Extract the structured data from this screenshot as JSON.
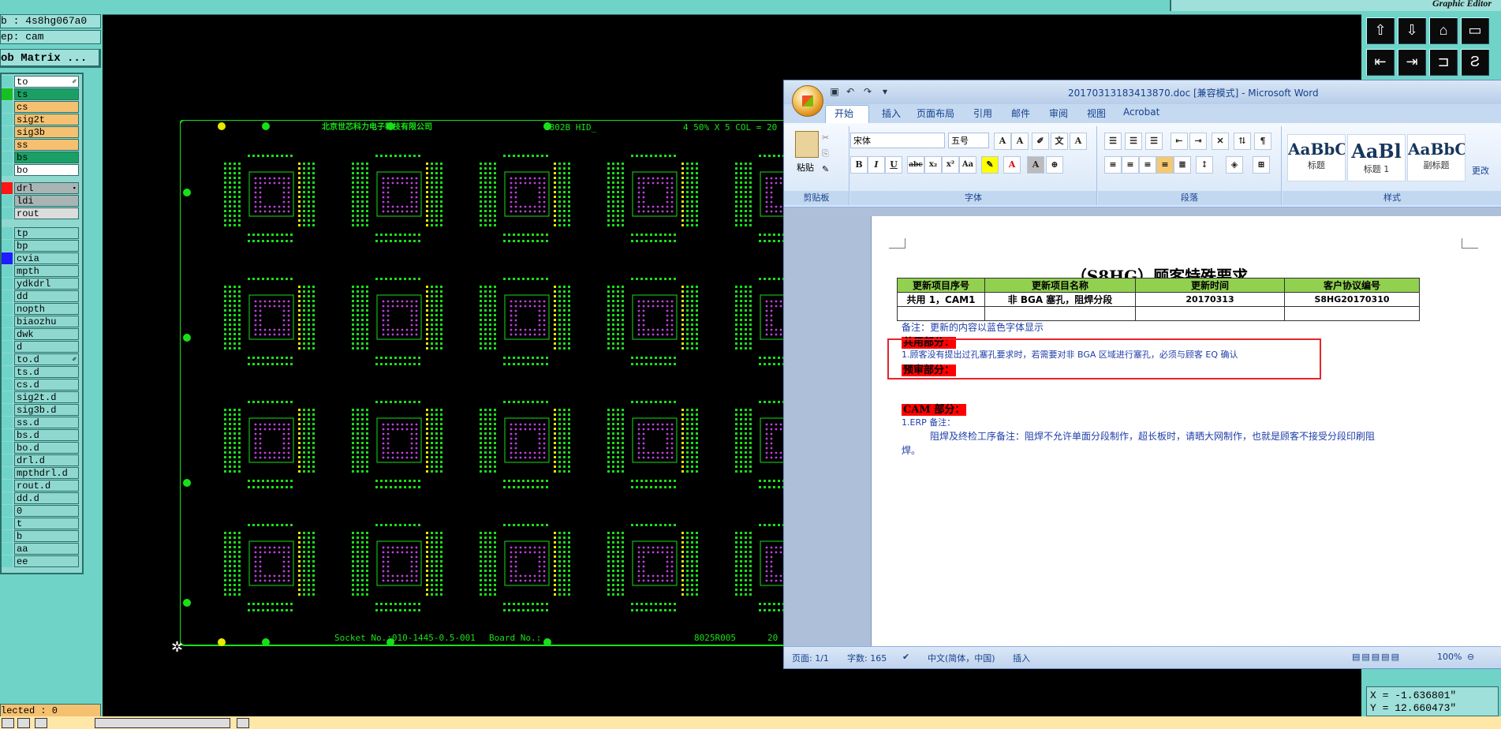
{
  "topbar": {
    "right_label": "Graphic Editor"
  },
  "left_panel": {
    "job": "b : 4s8hg067a0",
    "step": "ep: cam",
    "matrix_button": "ob Matrix ...",
    "selected": "lected : 0",
    "layers": [
      {
        "name": "to",
        "bg": "#ffffff",
        "swatch": "#6fd3c8",
        "flag": "✐"
      },
      {
        "name": "ts",
        "bg": "#1aa064",
        "swatch": "#15c022",
        "flag": ""
      },
      {
        "name": "cs",
        "bg": "#f5c070",
        "swatch": "#6fd3c8",
        "flag": ""
      },
      {
        "name": "sig2t",
        "bg": "#f5c070",
        "swatch": "#6fd3c8",
        "flag": ""
      },
      {
        "name": "sig3b",
        "bg": "#f5c070",
        "swatch": "#6fd3c8",
        "flag": ""
      },
      {
        "name": "ss",
        "bg": "#f5c070",
        "swatch": "#6fd3c8",
        "flag": ""
      },
      {
        "name": "bs",
        "bg": "#1aa064",
        "swatch": "#6fd3c8",
        "flag": ""
      },
      {
        "name": "bo",
        "bg": "#ffffff",
        "swatch": "#6fd3c8",
        "flag": ""
      },
      {
        "name": "drl",
        "bg": "#a9b4b4",
        "swatch": "#ff1515",
        "flag": "▪"
      },
      {
        "name": "ldi",
        "bg": "#a9b4b4",
        "swatch": "#6fd3c8",
        "flag": ""
      },
      {
        "name": "rout",
        "bg": "#dcdcdc",
        "swatch": "#6fd3c8",
        "flag": ""
      },
      {
        "name": "tp",
        "bg": "#8fd8d0",
        "swatch": "#6fd3c8",
        "flag": ""
      },
      {
        "name": "bp",
        "bg": "#8fd8d0",
        "swatch": "#6fd3c8",
        "flag": ""
      },
      {
        "name": "cvia",
        "bg": "#8fd8d0",
        "swatch": "#1d1dff",
        "flag": ""
      },
      {
        "name": "mpth",
        "bg": "#8fd8d0",
        "swatch": "#6fd3c8",
        "flag": ""
      },
      {
        "name": "ydkdrl",
        "bg": "#8fd8d0",
        "swatch": "#6fd3c8",
        "flag": ""
      },
      {
        "name": "dd",
        "bg": "#8fd8d0",
        "swatch": "#6fd3c8",
        "flag": ""
      },
      {
        "name": "nopth",
        "bg": "#8fd8d0",
        "swatch": "#6fd3c8",
        "flag": ""
      },
      {
        "name": "biaozhu",
        "bg": "#8fd8d0",
        "swatch": "#6fd3c8",
        "flag": ""
      },
      {
        "name": "dwk",
        "bg": "#8fd8d0",
        "swatch": "#6fd3c8",
        "flag": ""
      },
      {
        "name": "d",
        "bg": "#8fd8d0",
        "swatch": "#6fd3c8",
        "flag": ""
      },
      {
        "name": "to.d",
        "bg": "#8fd8d0",
        "swatch": "#6fd3c8",
        "flag": "✐"
      },
      {
        "name": "ts.d",
        "bg": "#8fd8d0",
        "swatch": "#6fd3c8",
        "flag": ""
      },
      {
        "name": "cs.d",
        "bg": "#8fd8d0",
        "swatch": "#6fd3c8",
        "flag": ""
      },
      {
        "name": "sig2t.d",
        "bg": "#8fd8d0",
        "swatch": "#6fd3c8",
        "flag": ""
      },
      {
        "name": "sig3b.d",
        "bg": "#8fd8d0",
        "swatch": "#6fd3c8",
        "flag": ""
      },
      {
        "name": "ss.d",
        "bg": "#8fd8d0",
        "swatch": "#6fd3c8",
        "flag": ""
      },
      {
        "name": "bs.d",
        "bg": "#8fd8d0",
        "swatch": "#6fd3c8",
        "flag": ""
      },
      {
        "name": "bo.d",
        "bg": "#8fd8d0",
        "swatch": "#6fd3c8",
        "flag": ""
      },
      {
        "name": "drl.d",
        "bg": "#8fd8d0",
        "swatch": "#6fd3c8",
        "flag": ""
      },
      {
        "name": "mpthdrl.d",
        "bg": "#8fd8d0",
        "swatch": "#6fd3c8",
        "flag": ""
      },
      {
        "name": "rout.d",
        "bg": "#8fd8d0",
        "swatch": "#6fd3c8",
        "flag": ""
      },
      {
        "name": "dd.d",
        "bg": "#8fd8d0",
        "swatch": "#6fd3c8",
        "flag": ""
      },
      {
        "name": "0",
        "bg": "#8fd8d0",
        "swatch": "#6fd3c8",
        "flag": ""
      },
      {
        "name": "t",
        "bg": "#8fd8d0",
        "swatch": "#6fd3c8",
        "flag": ""
      },
      {
        "name": "b",
        "bg": "#8fd8d0",
        "swatch": "#6fd3c8",
        "flag": ""
      },
      {
        "name": "aa",
        "bg": "#8fd8d0",
        "swatch": "#6fd3c8",
        "flag": ""
      },
      {
        "name": "ee",
        "bg": "#8fd8d0",
        "swatch": "#6fd3c8",
        "flag": ""
      }
    ]
  },
  "pcb": {
    "company_text": "北京世芯科力电子科技有限公司",
    "id_text": "1802B HID_",
    "size_text": "4 50% X 5 COL = 20",
    "socket_text": "Socket No.:010-1445-0.5-001",
    "board_text": "Board No.:",
    "code_text": "8025R005",
    "edge_text": "20",
    "trace_color": "#18e018",
    "pad_colors": [
      "#18e018",
      "#e8e800",
      "#c040e0"
    ],
    "fiducial_color": "#e8e800"
  },
  "tool_panel": {
    "coord_x": "X = -1.636801\"",
    "coord_y": "Y = 12.660473\""
  },
  "word": {
    "title": "20170313183413870.doc [兼容模式] - Microsoft Word",
    "tabs": [
      "开始",
      "插入",
      "页面布局",
      "引用",
      "邮件",
      "审阅",
      "视图",
      "Acrobat"
    ],
    "clipboard": {
      "paste": "粘贴",
      "label": "剪贴板"
    },
    "font": {
      "name": "宋体",
      "size": "五号",
      "label": "字体"
    },
    "paragraph_label": "段落",
    "styles": {
      "label": "样式",
      "items": [
        {
          "preview": "AaBbC",
          "caption": "标题"
        },
        {
          "preview": "AaBl",
          "caption": "标题 1"
        },
        {
          "preview": "AaBbC",
          "caption": "副标题"
        }
      ],
      "more": "更改"
    },
    "doc": {
      "title": "（S8HG）顾客特殊要求",
      "table_headers": [
        "更新项目序号",
        "更新项目名称",
        "更新时间",
        "客户协议编号"
      ],
      "table_row": [
        "共用 1，CAM1",
        "非 BGA 塞孔，阻焊分段",
        "20170313",
        "S8HG20170310"
      ],
      "note": "备注：更新的内容以蓝色字体显示",
      "shared_heading": "共用部分：",
      "line1": "1.顾客没有提出过孔塞孔要求时，若需要对非 BGA 区域进行塞孔，必须与顾客 EQ 确认",
      "pre_heading": "预审部分：",
      "cam_heading": "CAM 部分：",
      "erp": "1.ERP 备注：",
      "erp_text": "阻焊及终检工序备注：阻焊不允许单面分段制作，超长板时，请晒大网制作，也就是顾客不接受分段印刷阻",
      "erp_text2": "焊。"
    },
    "status": {
      "page": "页面: 1/1",
      "words": "字数: 165",
      "lang": "中文(简体，中国)",
      "mode": "插入",
      "zoom": "100%"
    },
    "colors": {
      "blue_text": "#1f3ea8",
      "highlight": "#ff0000",
      "header_fill": "#92d050",
      "red_box": "#e8232b"
    }
  }
}
